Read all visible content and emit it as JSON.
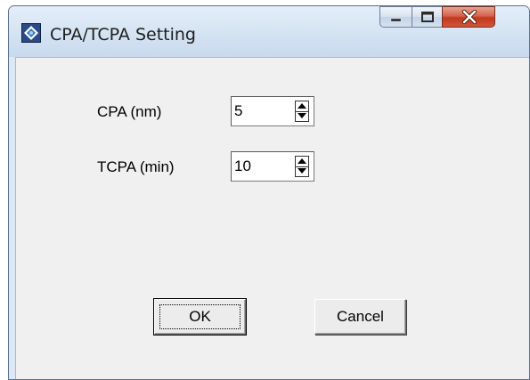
{
  "window": {
    "title": "CPA/TCPA Setting",
    "app_icon": "app-icon",
    "caption_buttons": [
      "minimize-icon",
      "maximize-icon",
      "close-icon"
    ]
  },
  "form": {
    "cpa": {
      "label": "CPA (nm)",
      "value": "5"
    },
    "tcpa": {
      "label": "TCPA (min)",
      "value": "10"
    }
  },
  "buttons": {
    "ok_label": "OK",
    "cancel_label": "Cancel"
  },
  "colors": {
    "frame": "#dce8f5",
    "client": "#f0f0f0",
    "close_button": "#c1381d"
  }
}
